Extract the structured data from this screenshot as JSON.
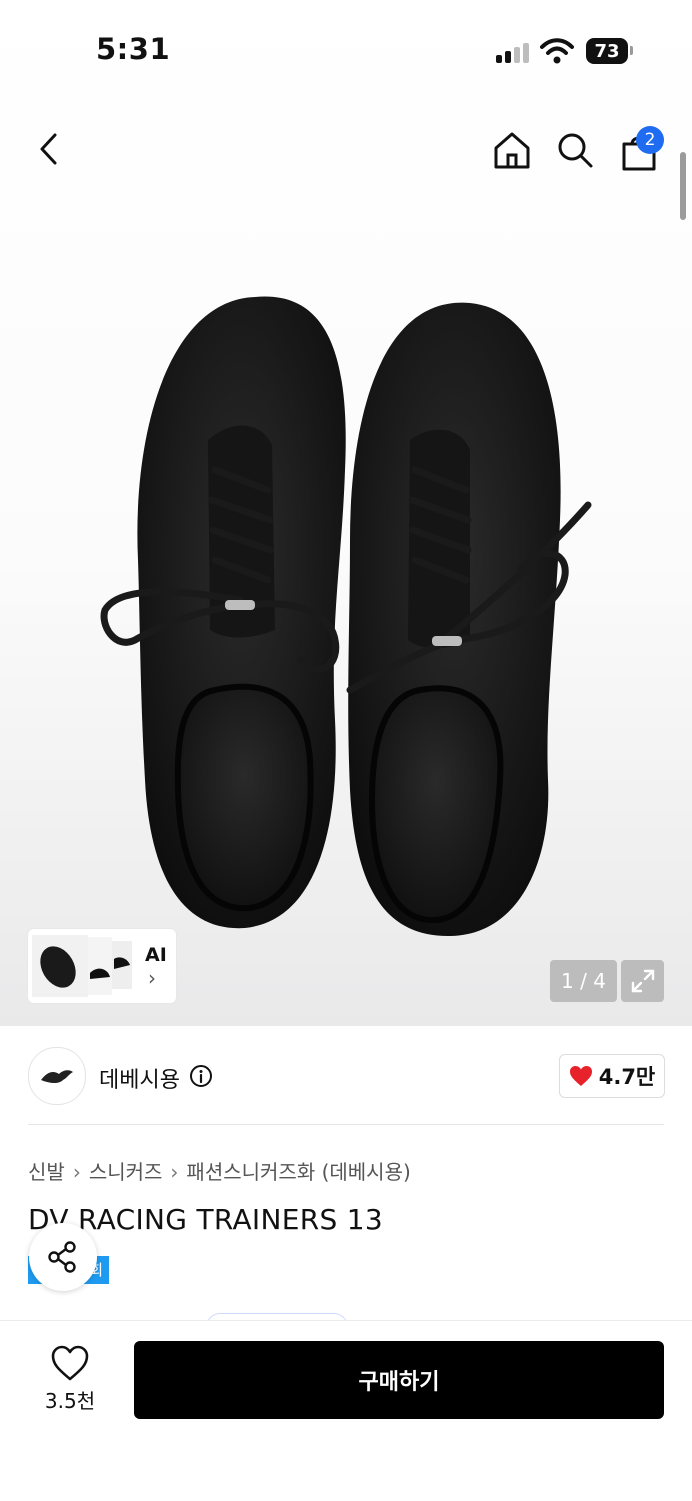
{
  "status_bar": {
    "time": "5:31",
    "battery": "73"
  },
  "nav": {
    "cart_count": "2"
  },
  "gallery": {
    "ai_label": "AI",
    "pager": "1 / 4"
  },
  "brand": {
    "name": "데베시용",
    "likes": "4.7만"
  },
  "breadcrumb": [
    "신발",
    "스니커즈",
    "패션스니커즈화 (데베시용)"
  ],
  "product": {
    "title": "DV RACING TRAINERS 13",
    "tag_text": "회"
  },
  "bottom_bar": {
    "wish_count": "3.5천",
    "buy_label": "구매하기"
  },
  "colors": {
    "accent_blue": "#1f6cf0",
    "tag_blue": "#1e9bf0",
    "heart_red": "#e8222a",
    "buy_black": "#000000"
  }
}
